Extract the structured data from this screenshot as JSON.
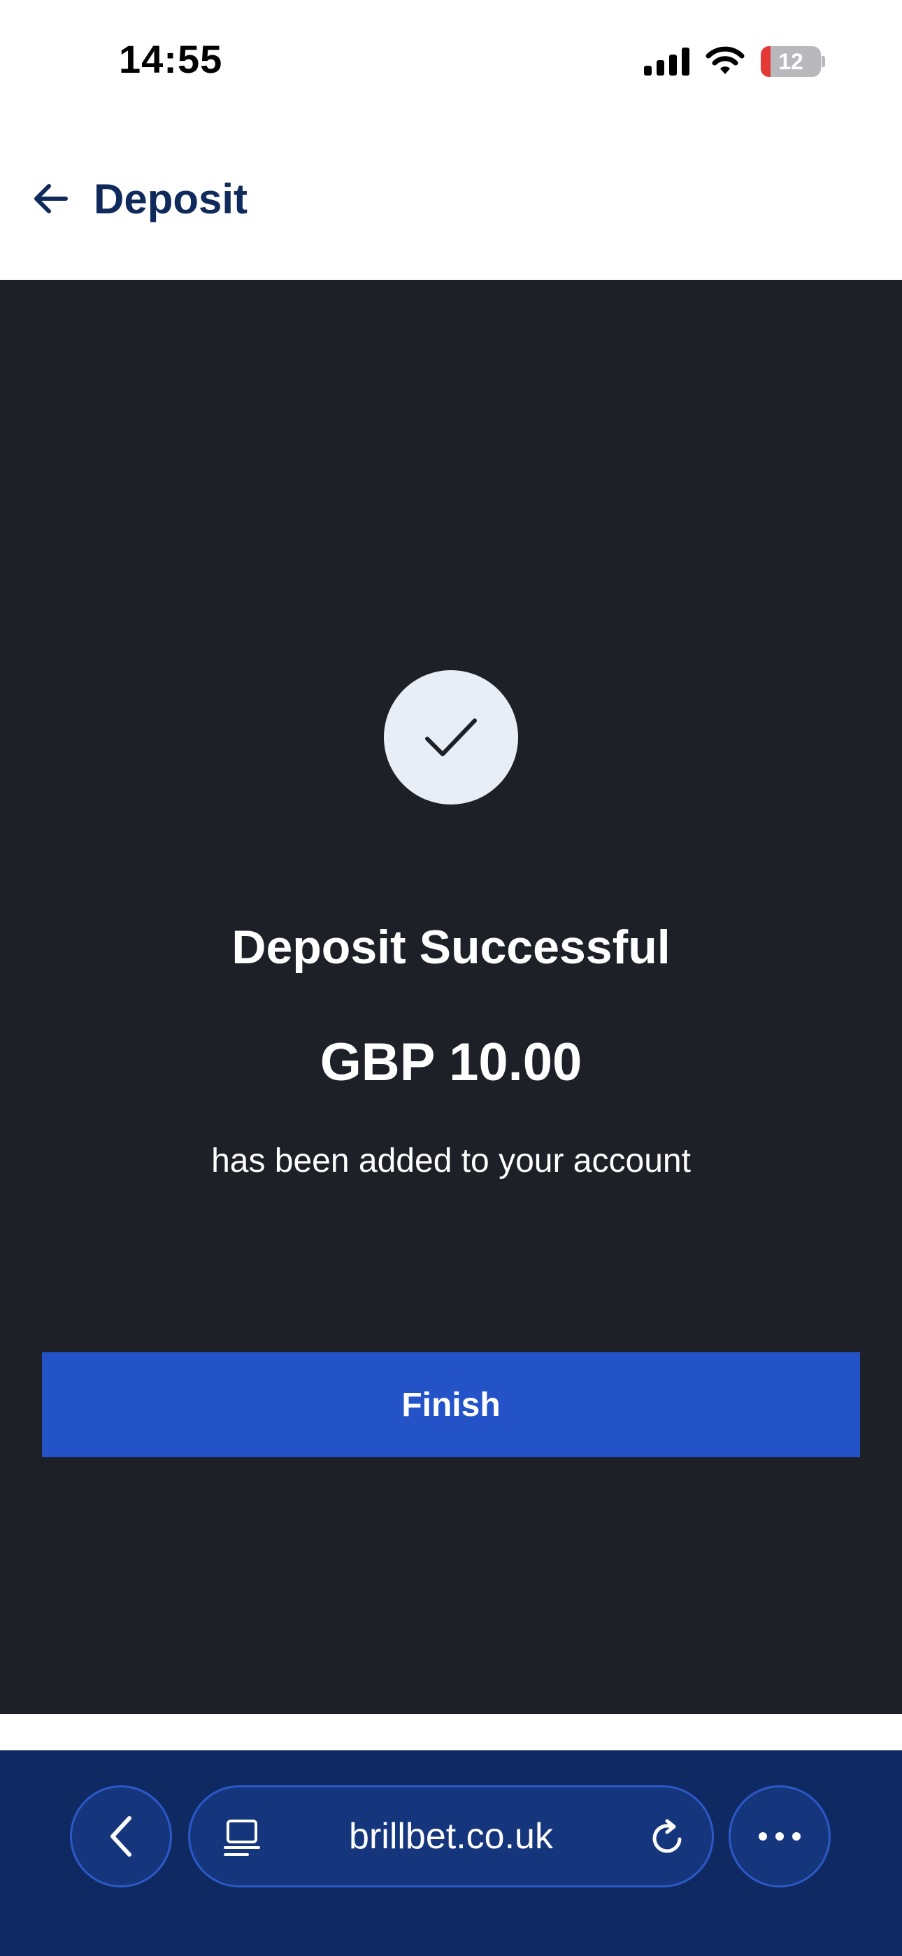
{
  "status_bar": {
    "time": "14:55",
    "battery_level": "12",
    "icons": [
      "signal-icon",
      "wifi-icon",
      "battery-icon"
    ]
  },
  "header": {
    "title": "Deposit",
    "back_icon": "arrow-left-icon"
  },
  "result": {
    "icon": "checkmark-icon",
    "title": "Deposit Successful",
    "amount": "GBP 10.00",
    "message": "has been added to your account",
    "finish_label": "Finish"
  },
  "browser": {
    "url": "brillbet.co.uk",
    "icons": [
      "chevron-left-icon",
      "tabs-icon",
      "reload-icon",
      "more-icon"
    ]
  },
  "colors": {
    "content_background": "#1e2028",
    "primary_button": "#2453c8",
    "header_text": "#102a5c",
    "browser_bar": "#0f2a63",
    "battery_low": "#e53935"
  }
}
